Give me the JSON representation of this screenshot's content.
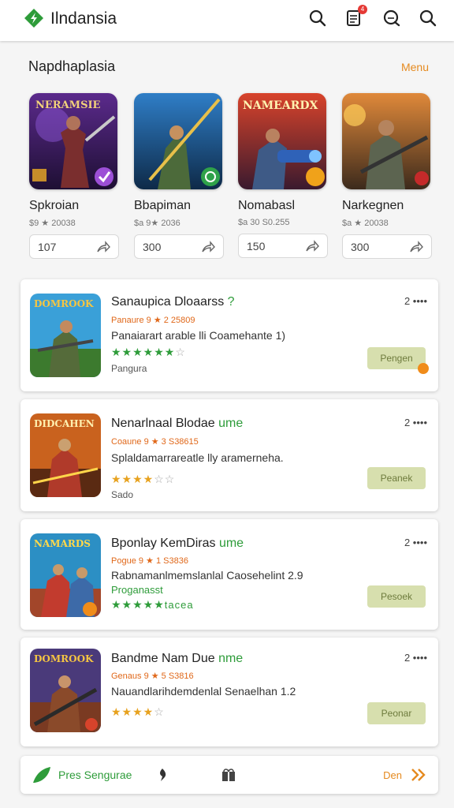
{
  "header": {
    "title": "Ilndansia",
    "notification_count": "4"
  },
  "section": {
    "title": "Napdhaplasia",
    "more": "Menu"
  },
  "featured": [
    {
      "art": "NERAMSIE",
      "name": "Spkroian",
      "price": "$9 ★ 20038",
      "count": "107"
    },
    {
      "art": "",
      "name": "Bbapiman",
      "price": "$a 9★ 2036",
      "count": "300"
    },
    {
      "art": "NAMEARDX",
      "name": "Nomabasl",
      "price": "$a 30 S0.255",
      "count": "150"
    },
    {
      "art": "",
      "name": "Narkegnen",
      "price": "$a ★ 20038",
      "count": "300"
    }
  ],
  "list": [
    {
      "title": "Sanaupica Dloaarss",
      "title_accent": "?",
      "sub": "Panaure 9 ★ 2 25809",
      "desc": "Panaiarart arable lli  Coamehante 1)",
      "stars": "★★★★★★",
      "stars_muted": "☆",
      "extra": "Pangura",
      "rank": "2 ••••",
      "button": "Pengen",
      "art": "DOMROOK"
    },
    {
      "title": "Nenarlnaal Blodae",
      "title_accent": "ume",
      "sub": "Coaune 9 ★ 3 S38615",
      "desc": "Splaldamarrareatle lly aramerneha.",
      "stars": "★★★★",
      "stars_muted": "☆☆",
      "extra": "Sado",
      "rank": "2 ••••",
      "button": "Peanek",
      "art": "DIDCAHEN"
    },
    {
      "title": "Bponlay KemDiras",
      "title_accent": "ume",
      "sub": "Pogue 9 ★ 1 S3836",
      "desc": "Rabnamanlmemslanlal Caosehelint  2.9",
      "stars": "★★★★★",
      "stars_muted": "",
      "extra": "Proganasst",
      "extra2": "tacea",
      "rank": "2 ••••",
      "button": "Pesoek",
      "art": "NAMARDS"
    },
    {
      "title": "Bandme Nam Due",
      "title_accent": "nme",
      "sub": "Genaus 9 ★ 5 S3816",
      "desc": "Nauandlarihdemdenlal Senaelhan 1.2",
      "stars": "★★★★",
      "stars_muted": "☆",
      "extra": "",
      "rank": "2 ••••",
      "button": "Peonar",
      "art": "DOMROOK"
    }
  ],
  "bottom": {
    "label": "Pres Sengurae",
    "more": "Den"
  },
  "colors": {
    "accent_green": "#2e9c3a",
    "accent_orange": "#e58a1f",
    "button_bg": "#d7dfae"
  }
}
